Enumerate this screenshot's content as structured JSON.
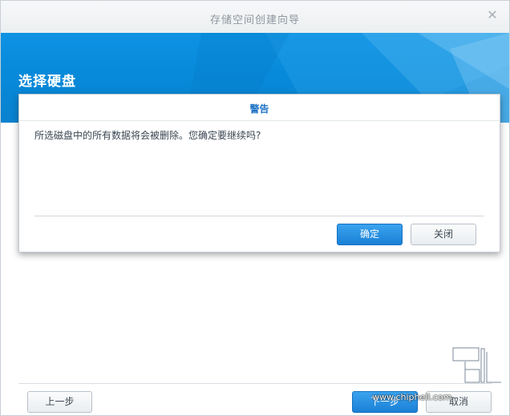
{
  "window": {
    "title": "存储空间创建向导",
    "close_glyph": "✕"
  },
  "banner": {
    "title": "选择硬盘",
    "color": "#0a8ad9"
  },
  "dialog": {
    "title": "警告",
    "message": "所选磁盘中的所有数据将会被删除。您确定要继续吗?",
    "ok_label": "确定",
    "close_label": "关闭"
  },
  "footer": {
    "prev_label": "上一步",
    "next_label": "下一步",
    "cancel_label": "取消"
  },
  "watermark": {
    "url": "www.chiphell.com",
    "logo_text": "chip hell"
  },
  "colors": {
    "accent": "#1a80d6",
    "dialog_title": "#1f73c5"
  }
}
